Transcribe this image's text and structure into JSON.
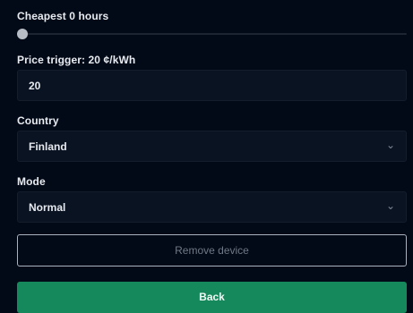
{
  "cheapest": {
    "label": "Cheapest 0 hours",
    "value": 0
  },
  "price_trigger": {
    "label": "Price trigger: 20 ¢/kWh",
    "value": "20"
  },
  "country": {
    "label": "Country",
    "selected": "Finland"
  },
  "mode": {
    "label": "Mode",
    "selected": "Normal"
  },
  "actions": {
    "remove_label": "Remove device",
    "back_label": "Back"
  },
  "colors": {
    "background": "#030a17",
    "field": "#0a1322",
    "back_button": "#15885c"
  },
  "icons": {
    "dropdown": "chevron-down-icon"
  }
}
